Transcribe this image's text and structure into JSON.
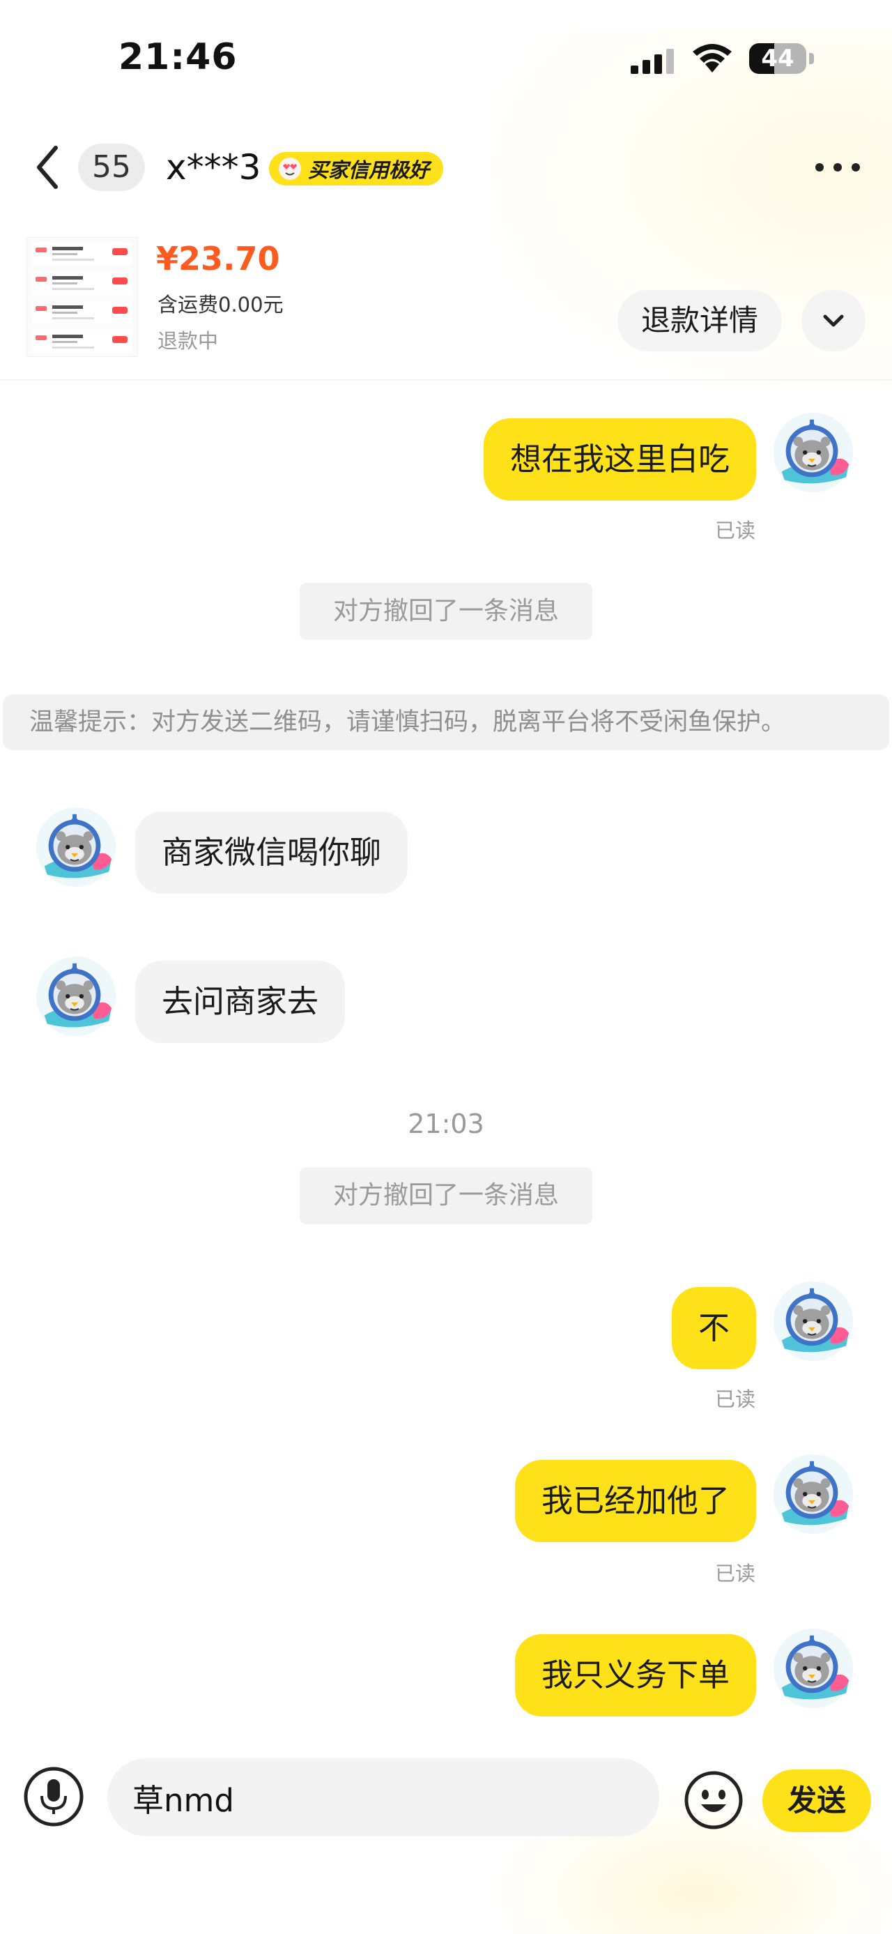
{
  "status_bar": {
    "time": "21:46",
    "battery_text": "44",
    "battery_level": 0.44
  },
  "header": {
    "unread_count": "55",
    "contact_name": "x***3",
    "credit_badge": "买家信用极好"
  },
  "product": {
    "price": "¥23.70",
    "shipping": "含运费0.00元",
    "status": "退款中",
    "refund_button": "退款详情"
  },
  "messages": {
    "m1": {
      "text": "想在我这里白吃",
      "read": "已读"
    },
    "recall1": "对方撤回了一条消息",
    "tip": "温馨提示：对方发送二维码，请谨慎扫码，脱离平台将不受闲鱼保护。",
    "m2": {
      "text": "商家微信喝你聊"
    },
    "m3": {
      "text": "去问商家去"
    },
    "timestamp": "21:03",
    "recall2": "对方撤回了一条消息",
    "m4": {
      "text": "不",
      "read": "已读"
    },
    "m5": {
      "text": "我已经加他了",
      "read": "已读"
    },
    "m6": {
      "text": "我只义务下单"
    }
  },
  "input": {
    "value": "草nmd",
    "send_label": "发送"
  },
  "colors": {
    "accent_yellow": "#ffe11a",
    "price_orange": "#ff5a1f",
    "bubble_gray": "#f3f3f3",
    "muted_text": "#999999"
  },
  "icons": {
    "back": "chevron-left-icon",
    "more": "more-dots-icon",
    "expand": "chevron-down-icon",
    "voice": "microphone-icon",
    "emoji": "smiley-icon",
    "credit": "heart-eyes-face-icon",
    "signal": "signal-icon",
    "wifi": "wifi-icon",
    "battery": "battery-icon"
  }
}
